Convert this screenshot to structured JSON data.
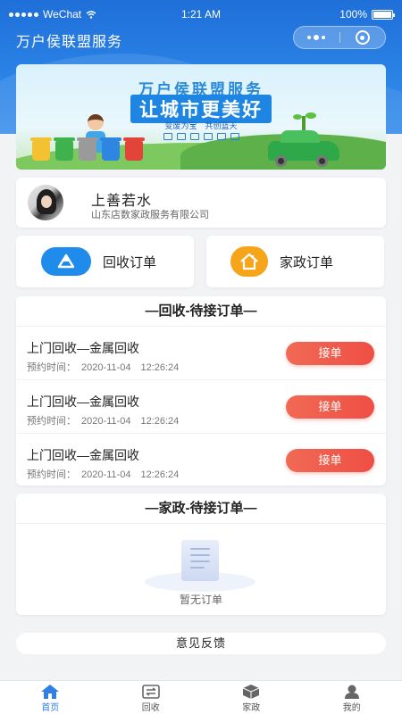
{
  "status_bar": {
    "carrier": "WeChat",
    "time": "1:21 AM",
    "battery": "100%"
  },
  "nav": {
    "title": "万户侯联盟服务"
  },
  "banner": {
    "title": "万户侯联盟服务",
    "slogan": "让城市更美好",
    "subtitle": "变废为宝　共创蓝天"
  },
  "profile": {
    "name": "上善若水",
    "company": "山东店数家政服务有限公司"
  },
  "order_buttons": {
    "recycle_label": "回收订单",
    "home_label": "家政订单"
  },
  "recycle_section": {
    "title": "—回收-待接订单—",
    "orders": [
      {
        "title": "上门回收—金属回收",
        "time_label": "预约时间：",
        "time_value": "2020-11-04　12:26:24",
        "action": "接单"
      },
      {
        "title": "上门回收—金属回收",
        "time_label": "预约时间：",
        "time_value": "2020-11-04　12:26:24",
        "action": "接单"
      },
      {
        "title": "上门回收—金属回收",
        "time_label": "预约时间：",
        "time_value": "2020-11-04　12:26:24",
        "action": "接单"
      }
    ]
  },
  "home_section": {
    "title": "—家政-待接订单—",
    "empty_text": "暂无订单"
  },
  "feedback_label": "意见反馈",
  "tabbar": {
    "items": [
      {
        "label": "首页",
        "icon": "home-icon",
        "active": true
      },
      {
        "label": "回收",
        "icon": "recycle-icon",
        "active": false
      },
      {
        "label": "家政",
        "icon": "box-icon",
        "active": false
      },
      {
        "label": "我的",
        "icon": "user-icon",
        "active": false
      }
    ]
  },
  "colors": {
    "primary": "#2f7fe6",
    "accept": "#ef4e43",
    "recycle_icon_bg": "#1f8ceb",
    "home_icon_bg": "#f6a51a"
  }
}
